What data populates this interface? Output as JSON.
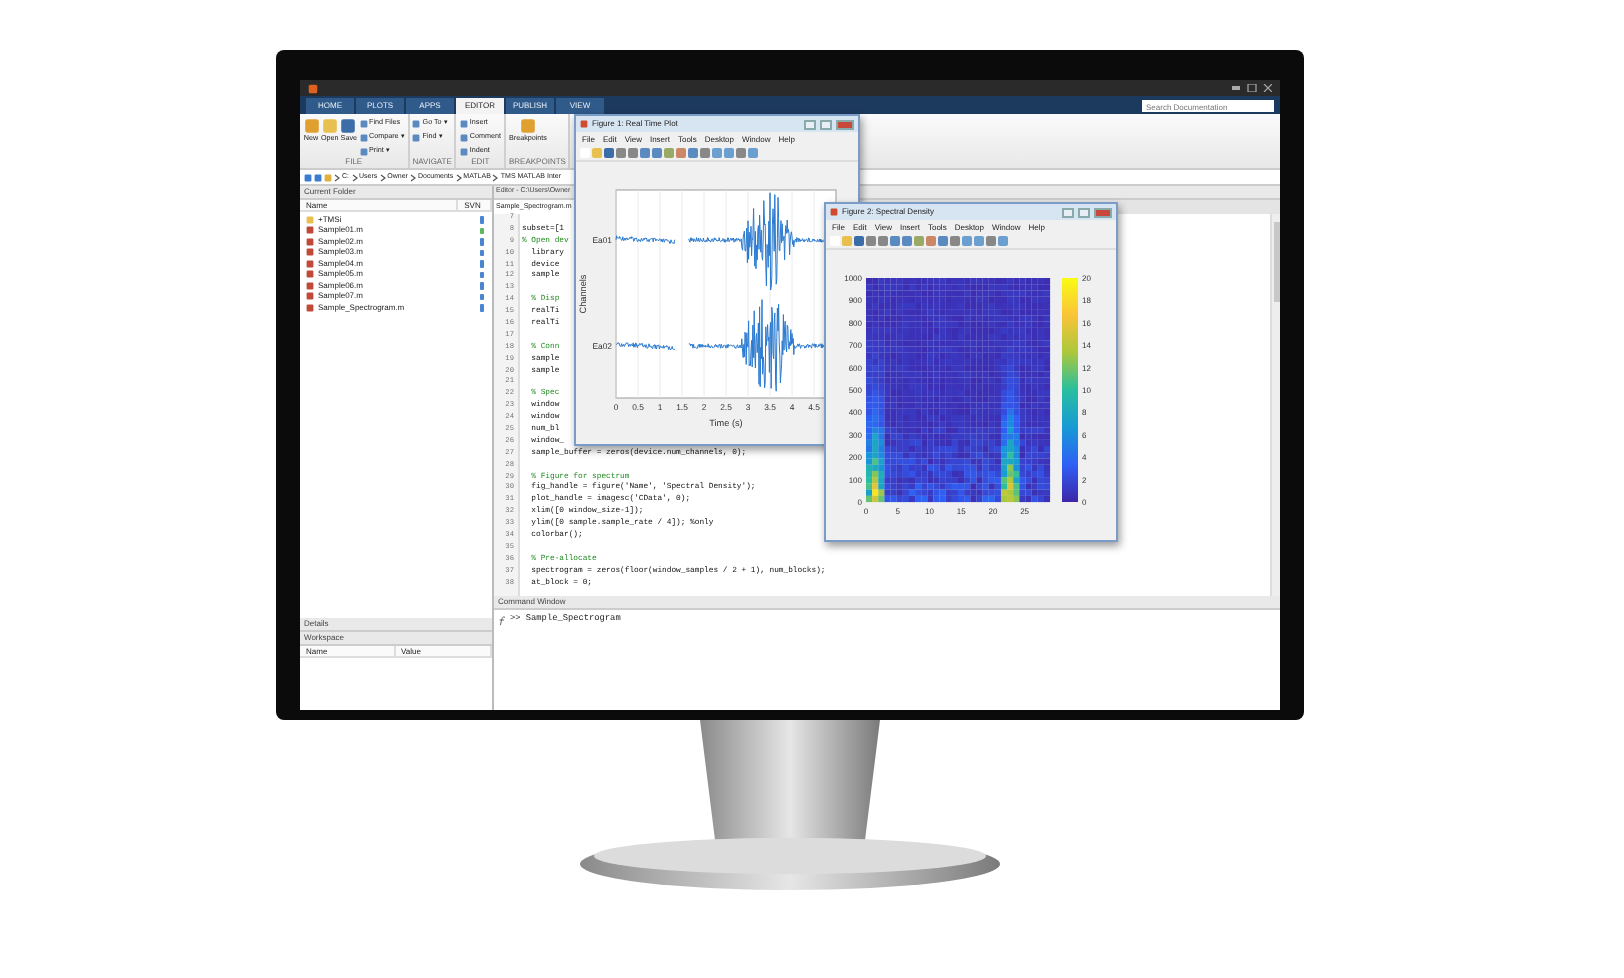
{
  "tabs": [
    {
      "label": "HOME",
      "selected": false
    },
    {
      "label": "PLOTS",
      "selected": false
    },
    {
      "label": "APPS",
      "selected": false
    },
    {
      "label": "EDITOR",
      "selected": true
    },
    {
      "label": "PUBLISH",
      "selected": false
    },
    {
      "label": "VIEW",
      "selected": false
    }
  ],
  "search": {
    "placeholder": "Search Documentation"
  },
  "toolstrip": [
    {
      "label": "FILE",
      "items": [
        {
          "label": "New",
          "kind": "large"
        },
        {
          "label": "Open",
          "kind": "large"
        },
        {
          "label": "Save",
          "kind": "large"
        },
        {
          "label": "Find Files",
          "kind": "small"
        },
        {
          "label": "Compare ▾",
          "kind": "small"
        },
        {
          "label": "Print ▾",
          "kind": "small"
        }
      ]
    },
    {
      "label": "NAVIGATE",
      "items": [
        {
          "label": "Go To ▾",
          "kind": "small"
        },
        {
          "label": "Find ▾",
          "kind": "small"
        }
      ]
    },
    {
      "label": "EDIT",
      "items": [
        {
          "label": "Insert",
          "kind": "small"
        },
        {
          "label": "Comment",
          "kind": "small"
        },
        {
          "label": "Indent",
          "kind": "small"
        }
      ]
    },
    {
      "label": "BREAKPOINTS",
      "items": [
        {
          "label": "Breakpoints",
          "kind": "large"
        }
      ]
    }
  ],
  "address": [
    "C:",
    "Users",
    "Owner",
    "Documents",
    "MATLAB",
    "TMS MATLAB Inter"
  ],
  "current_folder": {
    "title": "Current Folder",
    "columns": [
      "Name",
      "SVN"
    ],
    "files": [
      {
        "name": "+TMSi",
        "kind": "folder",
        "color": "#4a86d0"
      },
      {
        "name": "Sample01.m",
        "kind": "script",
        "color": "#5cb85c"
      },
      {
        "name": "Sample02.m",
        "kind": "script",
        "color": "#4a86d0"
      },
      {
        "name": "Sample03.m",
        "kind": "script",
        "color": "#4a86d0"
      },
      {
        "name": "Sample04.m",
        "kind": "script",
        "color": "#4a86d0"
      },
      {
        "name": "Sample05.m",
        "kind": "script",
        "color": "#4a86d0"
      },
      {
        "name": "Sample06.m",
        "kind": "script",
        "color": "#4a86d0"
      },
      {
        "name": "Sample07.m",
        "kind": "script",
        "color": "#4a86d0"
      },
      {
        "name": "Sample_Spectrogram.m",
        "kind": "script",
        "color": "#4a86d0"
      }
    ]
  },
  "details": {
    "title": "Details"
  },
  "workspace": {
    "title": "Workspace",
    "columns": [
      "Name",
      "Value"
    ]
  },
  "editor": {
    "title": "Editor - C:\\Users\\Owner",
    "tab": "Sample_Spectrogram.m",
    "lines": [
      {
        "n": "7"
      },
      {
        "n": "8",
        "text": "subset=[1",
        "kind": "code"
      },
      {
        "n": "9",
        "text": "% Open dev",
        "kind": "comment"
      },
      {
        "n": "10",
        "text": "  library",
        "kind": "code"
      },
      {
        "n": "11",
        "text": "  device",
        "kind": "code"
      },
      {
        "n": "12",
        "text": "  sample",
        "kind": "code"
      },
      {
        "n": "13"
      },
      {
        "n": "14",
        "text": "  % Disp",
        "kind": "comment"
      },
      {
        "n": "15",
        "text": "  realTi",
        "kind": "code"
      },
      {
        "n": "16",
        "text": "  realTi",
        "kind": "code"
      },
      {
        "n": "17"
      },
      {
        "n": "18",
        "text": "  % Conn",
        "kind": "comment"
      },
      {
        "n": "19",
        "text": "  sample",
        "kind": "code"
      },
      {
        "n": "20",
        "text": "  sample",
        "kind": "code"
      },
      {
        "n": "21"
      },
      {
        "n": "22",
        "text": "  % Spec",
        "kind": "comment"
      },
      {
        "n": "23",
        "text": "  window",
        "kind": "code"
      },
      {
        "n": "24",
        "text": "  window",
        "kind": "code"
      },
      {
        "n": "25",
        "text": "  num_bl",
        "kind": "code"
      },
      {
        "n": "26",
        "text": "  window_",
        "kind": "code"
      },
      {
        "n": "27",
        "text": "  sample_buffer = zeros(device.num_channels, 0);",
        "kind": "code"
      },
      {
        "n": "28"
      },
      {
        "n": "29",
        "text": "  % Figure for spectrum",
        "kind": "comment"
      },
      {
        "n": "30",
        "text": "  fig_handle = figure('Name', 'Spectral Density');",
        "kind": "code"
      },
      {
        "n": "31",
        "text": "  plot_handle = imagesc('CData', 0);",
        "kind": "code"
      },
      {
        "n": "32",
        "text": "  xlim([0 window_size-1]);",
        "kind": "code"
      },
      {
        "n": "33",
        "text": "  ylim([0 sample.sample_rate / 4]); %only",
        "kind": "code"
      },
      {
        "n": "34",
        "text": "  colorbar();",
        "kind": "code"
      },
      {
        "n": "35"
      },
      {
        "n": "36",
        "text": "  % Pre-allocate",
        "kind": "comment"
      },
      {
        "n": "37",
        "text": "  spectrogram = zeros(floor(window_samples / 2 + 1), num_blocks);",
        "kind": "code"
      },
      {
        "n": "38",
        "text": "  at_block = 0;",
        "kind": "code"
      }
    ]
  },
  "command_window": {
    "title": "Command Window",
    "lines": [
      ">> Sample_Spectrogram"
    ]
  },
  "figures": [
    {
      "kind": "waveform",
      "title": "Figure 1: Real Time Plot",
      "menus": [
        "File",
        "Edit",
        "View",
        "Insert",
        "Tools",
        "Desktop",
        "Window",
        "Help"
      ],
      "xlabel": "Time (s)",
      "ylabel": "Channels",
      "xticks": [
        "0",
        "0.5",
        "1",
        "1.5",
        "2",
        "2.5",
        "3",
        "3.5",
        "4",
        "4.5"
      ],
      "yticks": [
        "Ea01",
        "Ea02"
      ]
    },
    {
      "kind": "spectrogram",
      "title": "Figure 2: Spectral Density",
      "menus": [
        "File",
        "Edit",
        "View",
        "Insert",
        "Tools",
        "Desktop",
        "Window",
        "Help"
      ],
      "xticks": [
        "0",
        "5",
        "10",
        "15",
        "20",
        "25"
      ],
      "yticks": [
        "1000",
        "900",
        "800",
        "700",
        "600",
        "500",
        "400",
        "300",
        "200",
        "100",
        "0"
      ],
      "colorbar_ticks": [
        "20",
        "18",
        "16",
        "14",
        "12",
        "10",
        "8",
        "6",
        "4",
        "2",
        "0"
      ]
    }
  ]
}
